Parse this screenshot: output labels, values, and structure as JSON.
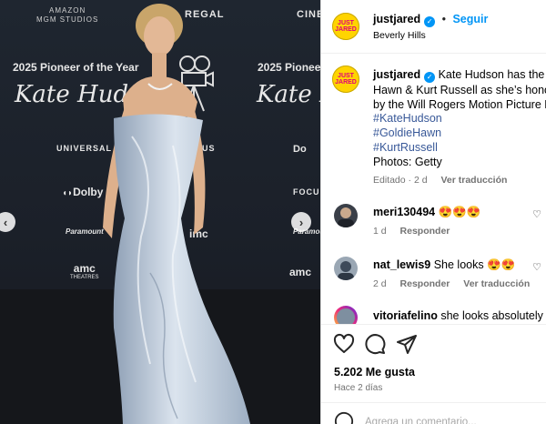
{
  "photo": {
    "wall": {
      "amazon_line1": "AMAZON",
      "amazon_line2": "MGM STUDIOS",
      "regal": "REGAL",
      "cine": "CINE",
      "pioneer_left": "2025 Pioneer of the Year",
      "pioneer_right": "2025 Pionee",
      "script_left": "Kate Huds",
      "script_right": "Kate Hu",
      "universal": "UNIVERSAL",
      "dolby": "Dolby",
      "dolby_right": "Do",
      "paramount": "Paramount",
      "paramount_right": "Paramount",
      "amc": "amc",
      "amc_sub": "THEATRES",
      "amc_right": "amc",
      "imc": "imc",
      "focus": "FOCU",
      "us": "US"
    },
    "prev_arrow": "‹",
    "next_arrow": "›"
  },
  "header": {
    "account": "justjared",
    "dot": "•",
    "follow": "Seguir",
    "location": "Beverly Hills",
    "avatar_text": "JUST JARED"
  },
  "caption": {
    "account": "justjared",
    "line1": "Kate Hudson has the su",
    "line2": "Hawn & Kurt Russell as she’s honore",
    "line3": "by the Will Rogers Motion Picture P",
    "hashtags": [
      "#KateHudson",
      "#GoldieHawn",
      "#KurtRussell"
    ],
    "photos": "Photos: Getty",
    "edited": "Editado · 2 d",
    "see_translation": "Ver traducción"
  },
  "comments": [
    {
      "user": "meri130494",
      "text": "😍😍😍",
      "time": "1 d",
      "reply": "Responder",
      "translate": ""
    },
    {
      "user": "nat_lewis9",
      "text": "She looks 😍😍",
      "time": "2 d",
      "reply": "Responder",
      "translate": "Ver traducción"
    },
    {
      "user": "vitoriafelino",
      "text": "she looks absolutely st",
      "time": "",
      "reply": "",
      "translate": ""
    }
  ],
  "actions": {
    "likes": "5.202 Me gusta",
    "ago": "Hace 2 días",
    "comment_placeholder": "Agrega un comentario..."
  },
  "colors": {
    "accent": "#0095f6",
    "hashtag": "#385898",
    "brand_avatar": "#ffd400",
    "brand_pink": "#e0007a"
  }
}
